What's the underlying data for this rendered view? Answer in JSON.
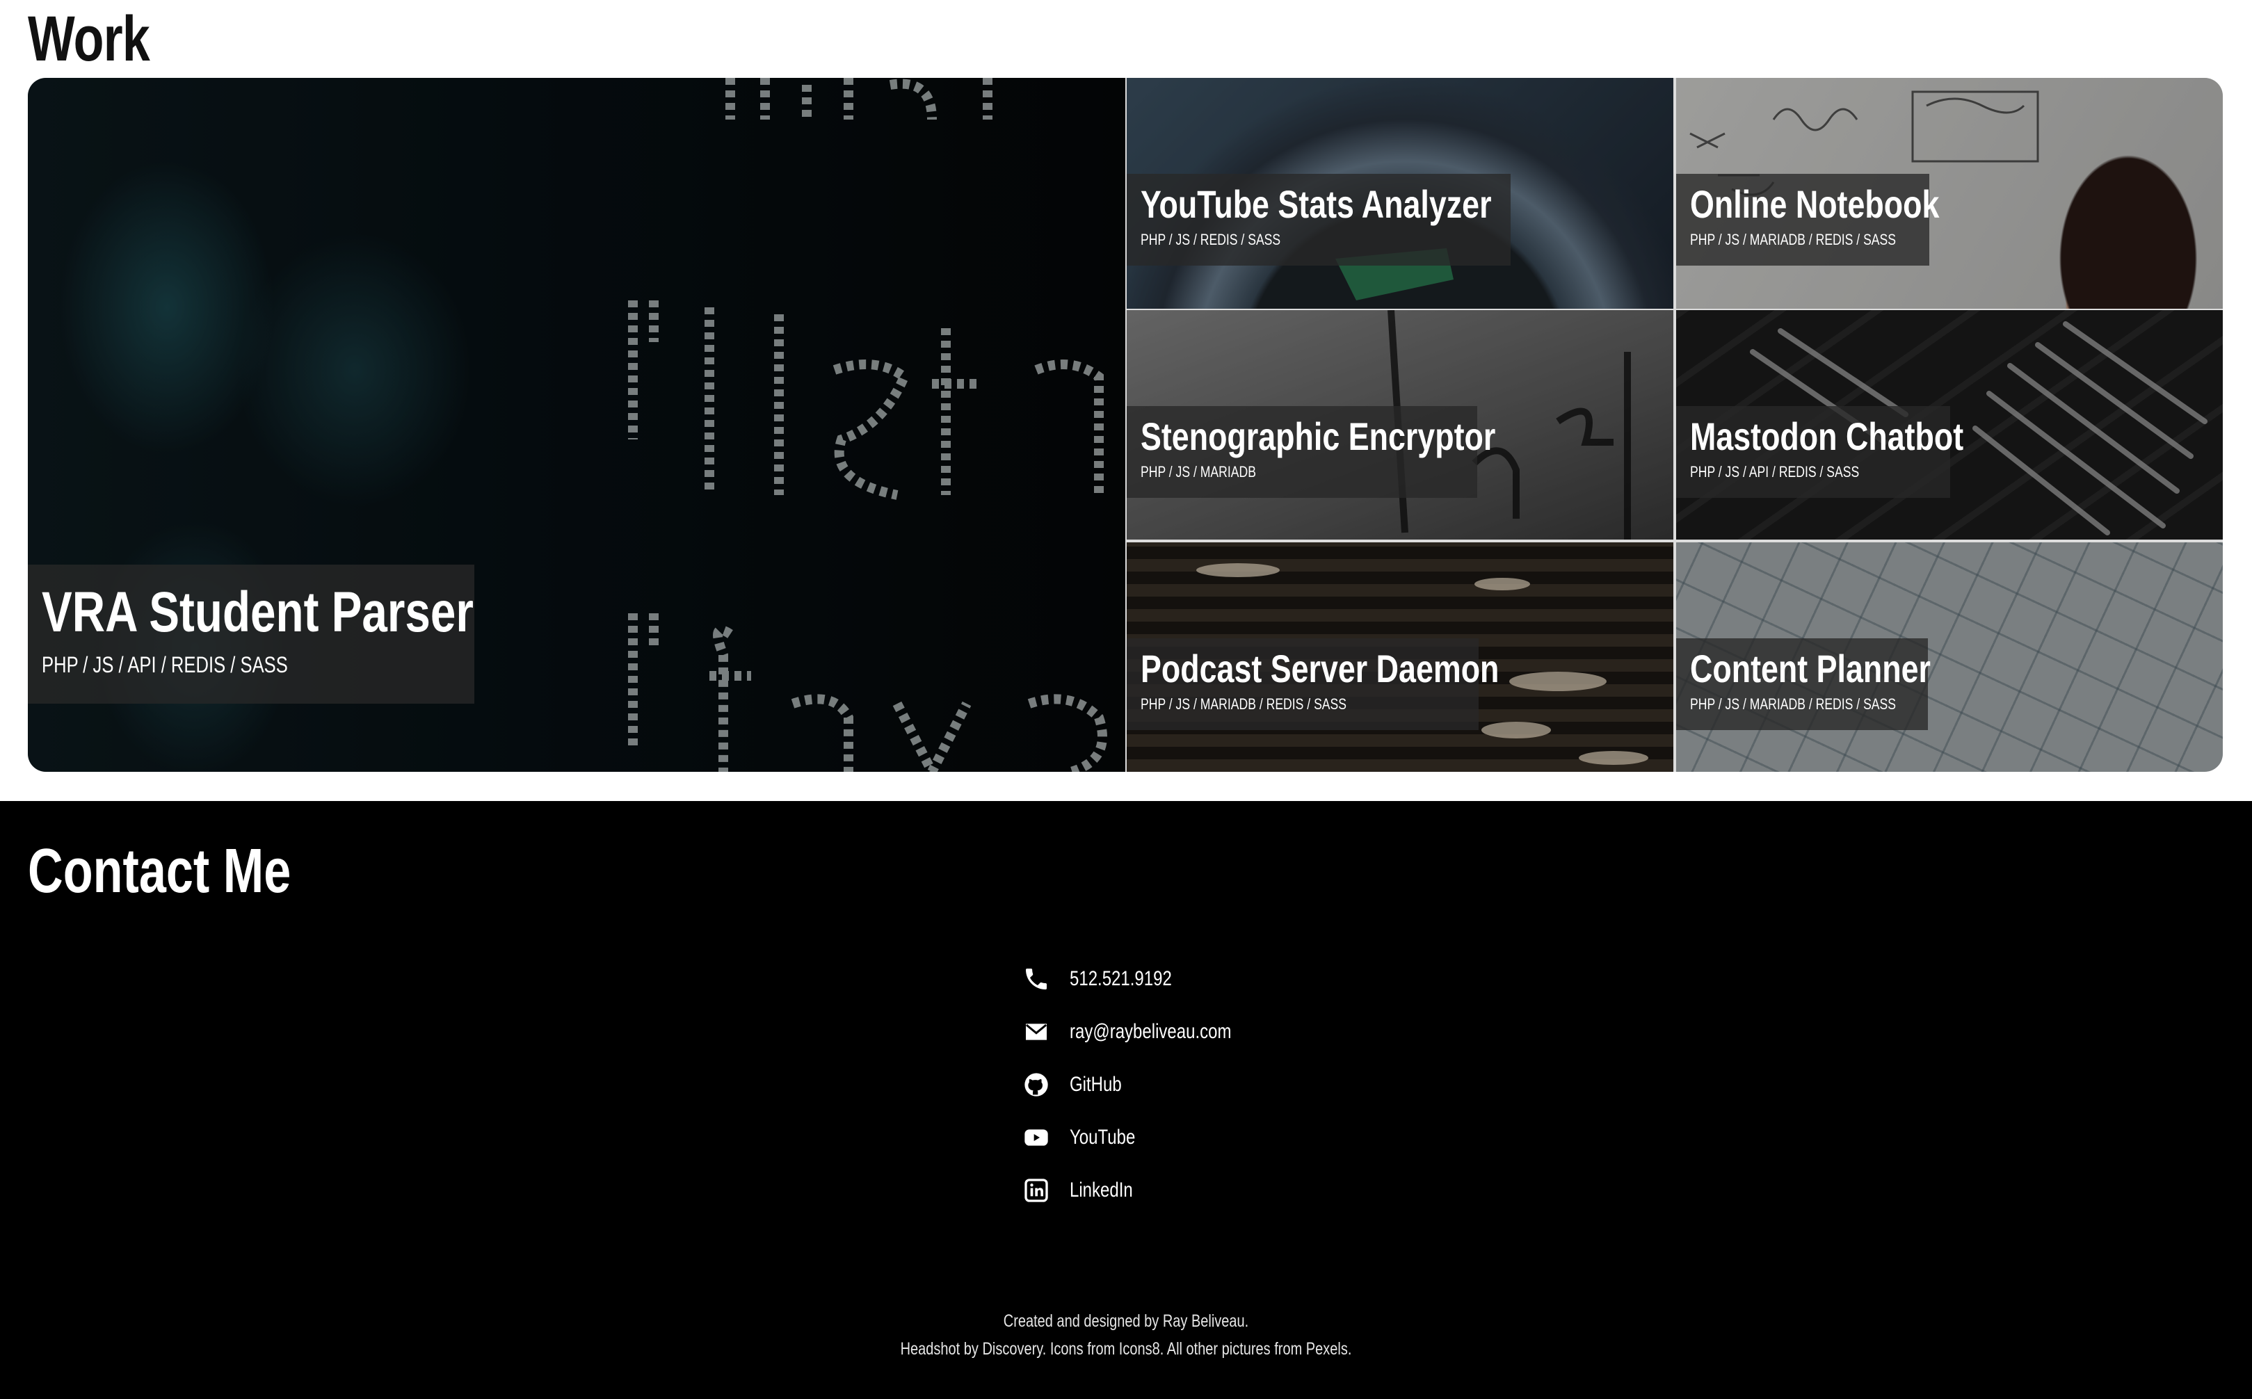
{
  "work": {
    "title": "Work",
    "projects": [
      {
        "title": "VRA Student Parser",
        "stack": "PHP / JS / API / REDIS / SASS"
      },
      {
        "title": "YouTube Stats Analyzer",
        "stack": "PHP / JS / REDIS / SASS"
      },
      {
        "title": "Online Notebook",
        "stack": "PHP / JS / MARIADB / REDIS / SASS"
      },
      {
        "title": "Stenographic Encryptor",
        "stack": "PHP / JS / MARIADB"
      },
      {
        "title": "Mastodon Chatbot",
        "stack": "PHP / JS / API / REDIS / SASS"
      },
      {
        "title": "Podcast Server Daemon",
        "stack": "PHP / JS / MARIADB / REDIS / SASS"
      },
      {
        "title": "Content Planner",
        "stack": "PHP / JS / MARIADB / REDIS / SASS"
      }
    ]
  },
  "contact": {
    "title": "Contact Me",
    "items": [
      {
        "icon": "phone-icon",
        "label": "512.521.9192"
      },
      {
        "icon": "mail-icon",
        "label": "ray@raybeliveau.com"
      },
      {
        "icon": "github-icon",
        "label": "GitHub"
      },
      {
        "icon": "youtube-icon",
        "label": "YouTube"
      },
      {
        "icon": "linkedin-icon",
        "label": "LinkedIn"
      }
    ]
  },
  "footer": {
    "line1": "Created and designed by Ray Beliveau.",
    "line2": "Headshot by Discovery. Icons from Icons8. All other pictures from Pexels."
  },
  "colors": {
    "contact_background": "#000000",
    "page_background": "#ffffff",
    "caption_background": "#282828"
  }
}
